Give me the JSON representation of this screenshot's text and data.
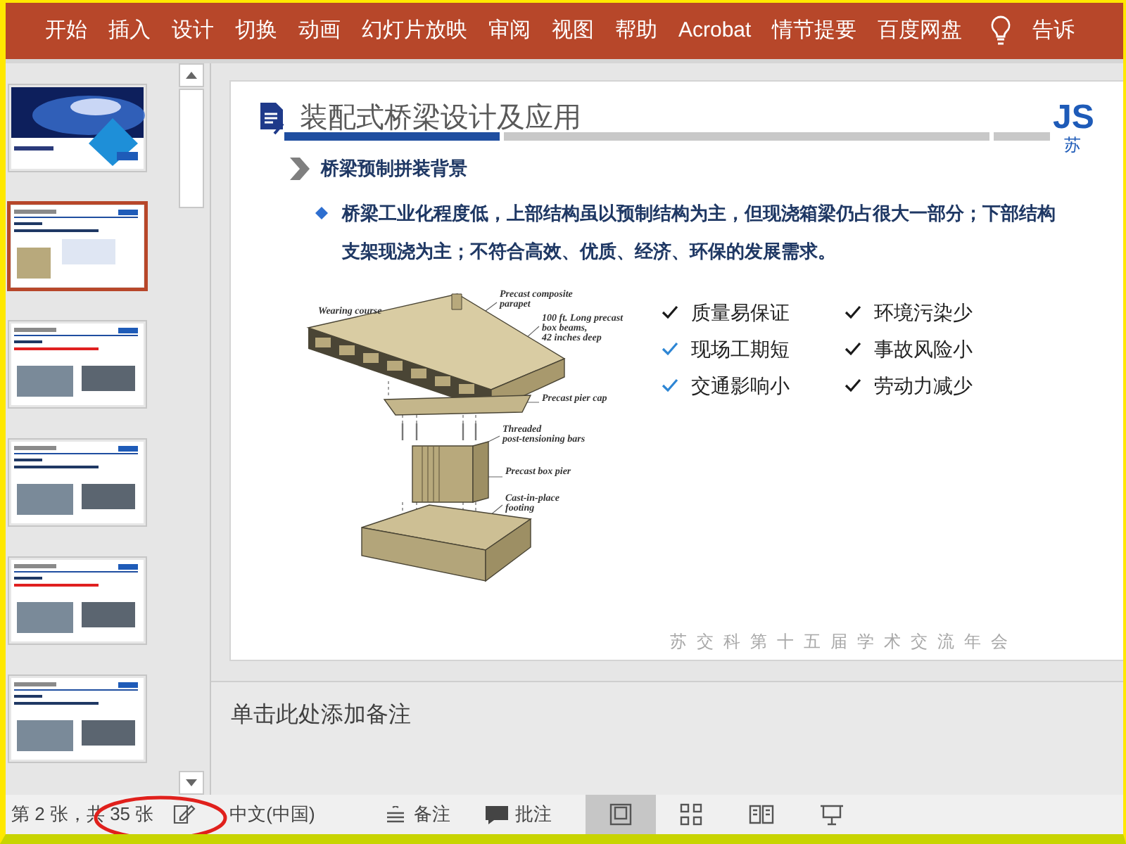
{
  "ribbon": {
    "tabs": [
      {
        "label": "开始"
      },
      {
        "label": "插入"
      },
      {
        "label": "设计"
      },
      {
        "label": "切换"
      },
      {
        "label": "动画"
      },
      {
        "label": "幻灯片放映"
      },
      {
        "label": "审阅"
      },
      {
        "label": "视图"
      },
      {
        "label": "帮助"
      },
      {
        "label": "Acrobat"
      },
      {
        "label": "情节提要"
      },
      {
        "label": "百度网盘"
      }
    ],
    "tell_me": "告诉"
  },
  "thumbnails": [
    {
      "kind": "title",
      "selected": false
    },
    {
      "kind": "content",
      "selected": true
    },
    {
      "kind": "content",
      "selected": false
    },
    {
      "kind": "content",
      "selected": false
    },
    {
      "kind": "content",
      "selected": false
    },
    {
      "kind": "content",
      "selected": false
    }
  ],
  "slide": {
    "title": "装配式桥梁设计及应用",
    "logo": "JS",
    "logo_sub": "苏",
    "subtitle": "桥梁预制拼装背景",
    "bullet_lines": [
      "桥梁工业化程度低，上部结构虽以预制结构为主，但现浇箱梁仍占很大一部分；下部结构",
      "支架现浇为主；不符合高效、优质、经济、环保的发展需求。"
    ],
    "diagram_labels": [
      "Wearing course",
      "Precast composite",
      "parapet",
      "100 ft. Long precast",
      "box beams,",
      "42 inches deep",
      "Precast pier cap",
      "Threaded",
      "post-tensioning bars",
      "Precast box pier",
      "Cast-in-place",
      "footing"
    ],
    "checklist": [
      {
        "text": "质量易保证",
        "color": "#1a1a1a"
      },
      {
        "text": "环境污染少",
        "color": "#1a1a1a"
      },
      {
        "text": "现场工期短",
        "color": "#2e86d4"
      },
      {
        "text": "事故风险小",
        "color": "#1a1a1a"
      },
      {
        "text": "交通影响小",
        "color": "#2e86d4"
      },
      {
        "text": "劳动力减少",
        "color": "#1a1a1a"
      }
    ],
    "footer": "苏交科第十五届学术交流年会"
  },
  "notes": {
    "placeholder": "单击此处添加备注"
  },
  "status_bar": {
    "slide_count": "第 2 张，共 35 张",
    "language": "中文(中国)",
    "notes": "备注",
    "comments": "批注",
    "views": [
      {
        "kind": "normal",
        "selected": true
      },
      {
        "kind": "sorter",
        "selected": false
      },
      {
        "kind": "reading",
        "selected": false
      },
      {
        "kind": "show",
        "selected": false
      }
    ]
  },
  "annotation": {
    "kind": "ellipse",
    "color": "#e0201c"
  }
}
